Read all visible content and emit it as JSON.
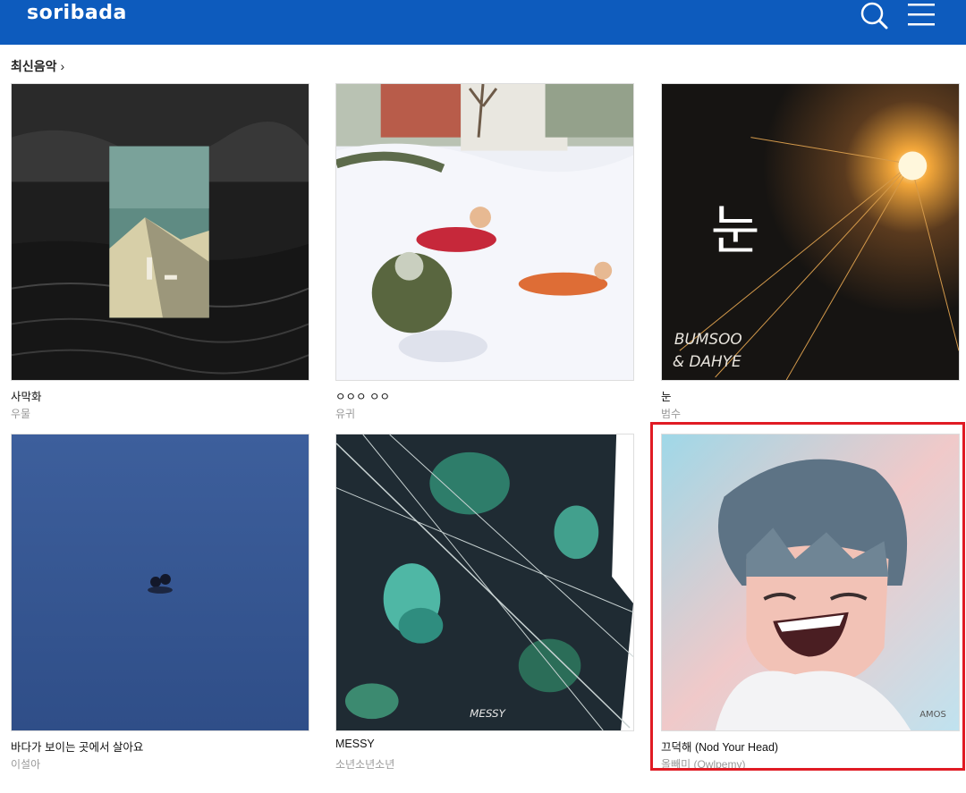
{
  "header": {
    "logo": "soribada",
    "search_icon": "search-icon",
    "menu_icon": "hamburger-menu-icon",
    "bg_color": "#0d5bbd"
  },
  "section": {
    "title": "최신음악",
    "chevron": "›"
  },
  "albums": [
    {
      "title": "사막화",
      "artist": "우물"
    },
    {
      "title": "ㅇㅇㅇ ㅇㅇ",
      "artist": "유귀"
    },
    {
      "title": "눈",
      "artist": "범수",
      "cover_text": [
        "눈",
        "BUMSOO",
        "& DAHYE"
      ]
    },
    {
      "title": "바다가 보이는 곳에서 살아요",
      "artist": "이설아"
    },
    {
      "title": "MESSY",
      "artist": "소년소년소년",
      "cover_text": [
        "MESSY"
      ]
    },
    {
      "title": "끄덕해 (Nod Your Head)",
      "artist": "올빼미 (Owlpemy)",
      "cover_text": [
        "AMOS"
      ],
      "highlighted": true
    }
  ],
  "highlight_color": "#e01b24"
}
